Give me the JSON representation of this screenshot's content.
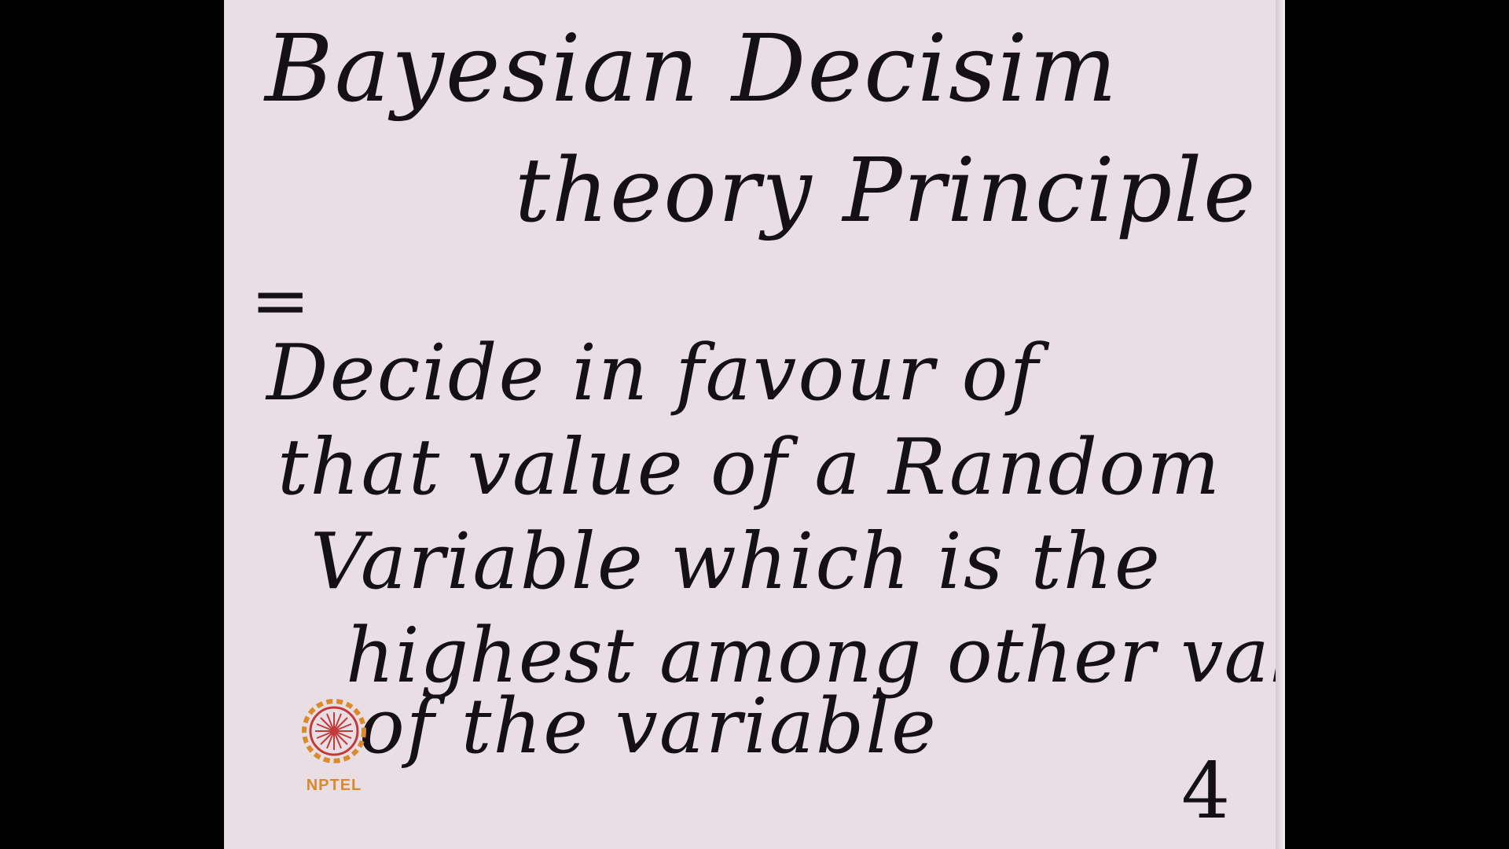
{
  "slide": {
    "title_line1": "Bayesian Decisim",
    "title_line2": "theory Principle :",
    "equals_mark": "=",
    "body_lines": [
      "Decide in favour of",
      "that value of a Random",
      "Variable which is the",
      "highest among other values",
      "of the variable"
    ],
    "page_number": "4"
  },
  "logo": {
    "name": "nptel-logo-icon",
    "text": "NPTEL"
  },
  "colors": {
    "background": "#000000",
    "paper": "#e9dee4",
    "ink": "#141014",
    "logo_orange": "#d98a2a",
    "logo_red": "#c23a3a"
  }
}
